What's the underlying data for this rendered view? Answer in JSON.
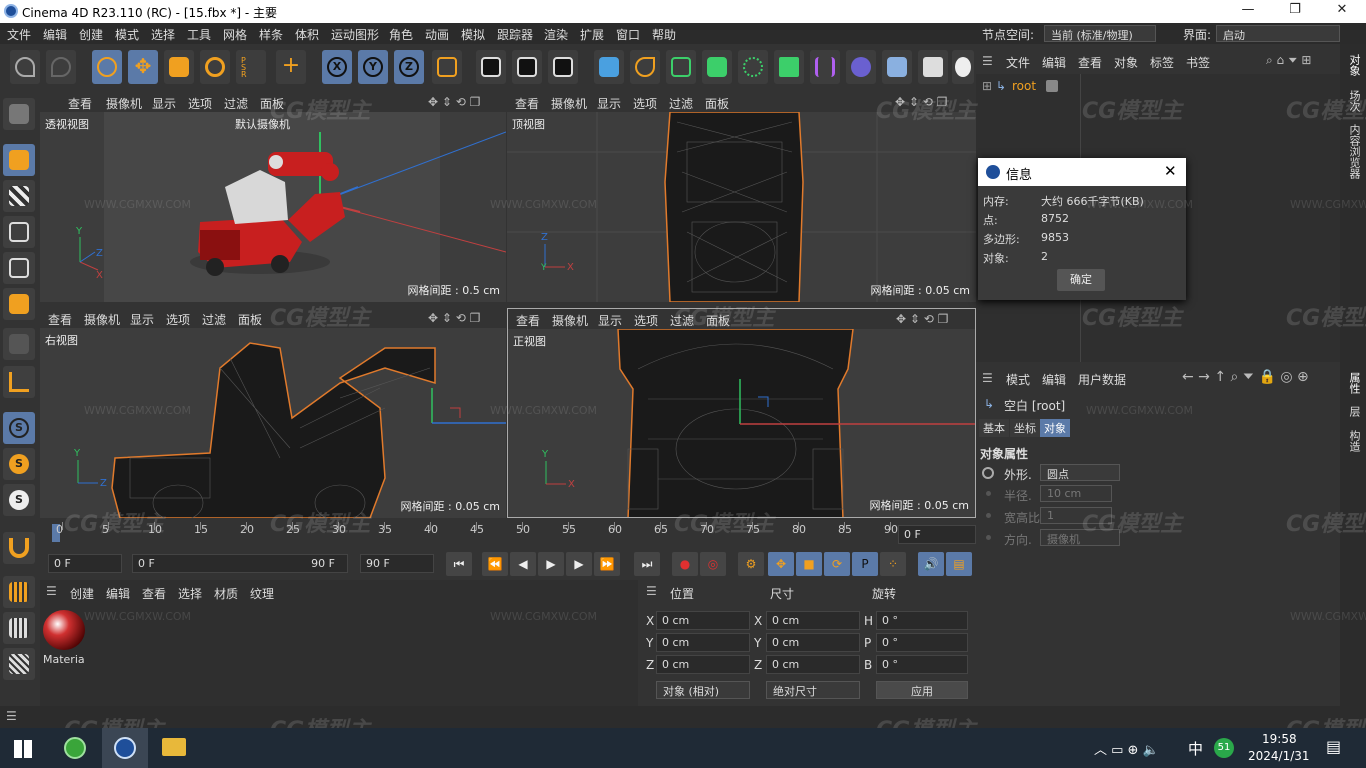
{
  "titlebar": {
    "title": "Cinema 4D R23.110 (RC) - [15.fbx *] - 主要"
  },
  "menu": [
    "文件",
    "编辑",
    "创建",
    "模式",
    "选择",
    "工具",
    "网格",
    "样条",
    "体积",
    "运动图形",
    "角色",
    "动画",
    "模拟",
    "跟踪器",
    "渲染",
    "扩展",
    "窗口",
    "帮助"
  ],
  "menu_right": {
    "node_space_label": "节点空间:",
    "node_space_value": "当前 (标准/物理)",
    "interface_label": "界面:",
    "interface_value": "启动"
  },
  "viewports": [
    {
      "menu": [
        "查看",
        "摄像机",
        "显示",
        "选项",
        "过滤",
        "面板"
      ],
      "name": "透视视图",
      "camera": "默认摄像机",
      "grid": "网格间距 : 0.5 cm"
    },
    {
      "menu": [
        "查看",
        "摄像机",
        "显示",
        "选项",
        "过滤",
        "面板"
      ],
      "name": "顶视图",
      "grid": "网格间距 : 0.05 cm"
    },
    {
      "menu": [
        "查看",
        "摄像机",
        "显示",
        "选项",
        "过滤",
        "面板"
      ],
      "name": "右视图",
      "grid": "网格间距 : 0.05 cm"
    },
    {
      "menu": [
        "查看",
        "摄像机",
        "显示",
        "选项",
        "过滤",
        "面板"
      ],
      "name": "正视图",
      "grid": "网格间距 : 0.05 cm"
    }
  ],
  "timeline": {
    "ticks": [
      "0",
      "5",
      "10",
      "15",
      "20",
      "25",
      "30",
      "35",
      "40",
      "45",
      "50",
      "55",
      "60",
      "65",
      "70",
      "75",
      "80",
      "85",
      "90"
    ],
    "end_field": "0 F"
  },
  "transport": {
    "start": "0 F",
    "current": "0 F",
    "range_end": "90 F",
    "end": "90 F"
  },
  "material_panel": {
    "menu": [
      "创建",
      "编辑",
      "查看",
      "选择",
      "材质",
      "纹理"
    ],
    "material_name": "Materia"
  },
  "coord_panel": {
    "headers": [
      "位置",
      "尺寸",
      "旋转"
    ],
    "rows": [
      {
        "axis": "X",
        "pos": "0 cm",
        "size_axis": "X",
        "size": "0 cm",
        "rot_axis": "H",
        "rot": "0 °"
      },
      {
        "axis": "Y",
        "pos": "0 cm",
        "size_axis": "Y",
        "size": "0 cm",
        "rot_axis": "P",
        "rot": "0 °"
      },
      {
        "axis": "Z",
        "pos": "0 cm",
        "size_axis": "Z",
        "size": "0 cm",
        "rot_axis": "B",
        "rot": "0 °"
      }
    ],
    "mode_select": "对象 (相对)",
    "size_select": "绝对尺寸",
    "apply": "应用"
  },
  "object_manager": {
    "menu": [
      "文件",
      "编辑",
      "查看",
      "对象",
      "标签",
      "书签"
    ],
    "root": "root"
  },
  "info_dialog": {
    "title": "信息",
    "rows": [
      {
        "label": "内存:",
        "value": "大约 666千字节(KB)"
      },
      {
        "label": "点:",
        "value": "8752"
      },
      {
        "label": "多边形:",
        "value": "9853"
      },
      {
        "label": "对象:",
        "value": "2"
      }
    ],
    "ok": "确定"
  },
  "attribute_manager": {
    "menu": [
      "模式",
      "编辑",
      "用户数据"
    ],
    "object": "空白 [root]",
    "tabs": [
      "基本",
      "坐标",
      "对象"
    ],
    "section": "对象属性",
    "props": [
      {
        "label": "外形.",
        "value": "圆点"
      },
      {
        "label": "半径.",
        "value": "10 cm"
      },
      {
        "label": "宽高比",
        "value": "1"
      },
      {
        "label": "方向.",
        "value": "摄像机"
      }
    ]
  },
  "side_tabs": [
    "对象",
    "场次",
    "内容浏览器",
    "属性",
    "层",
    "构造"
  ],
  "watermark": {
    "brand": "CG模型主",
    "url": "WWW.CGMXW.COM"
  },
  "taskbar": {
    "time": "19:58",
    "date": "2024/1/31",
    "ime": "中",
    "badge": "51"
  },
  "colors": {
    "accent": "#5b7aa8",
    "panel": "#333333",
    "viewport": "#3d3d3d",
    "wire_orange": "#e07a2c",
    "car_red": "#c81f1f"
  }
}
